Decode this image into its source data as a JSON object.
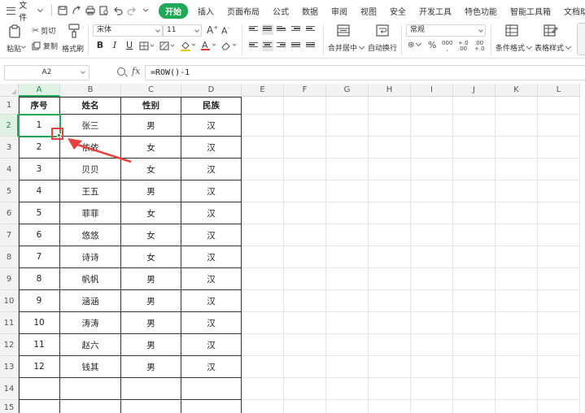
{
  "menubar": {
    "file_label": "文件",
    "tabs": [
      {
        "label": "开始",
        "active": true
      },
      {
        "label": "插入",
        "active": false
      },
      {
        "label": "页面布局",
        "active": false
      },
      {
        "label": "公式",
        "active": false
      },
      {
        "label": "数据",
        "active": false
      },
      {
        "label": "审阅",
        "active": false
      },
      {
        "label": "视图",
        "active": false
      },
      {
        "label": "安全",
        "active": false
      },
      {
        "label": "开发工具",
        "active": false
      },
      {
        "label": "特色功能",
        "active": false
      },
      {
        "label": "智能工具箱",
        "active": false
      },
      {
        "label": "文档助手",
        "active": false
      }
    ],
    "active_color": "#1fa855"
  },
  "ribbon": {
    "paste_label": "粘贴",
    "cut_label": "剪切",
    "copy_label": "复制",
    "format_painter_label": "格式刷",
    "font_name": "宋体",
    "font_size": "11",
    "bold": "B",
    "italic": "I",
    "underline": "U",
    "number_format": "常规",
    "merge_center_label": "合并居中",
    "wrap_text_label": "自动换行",
    "conditional_format_label": "条件格式",
    "table_style_label": "表格样式",
    "percent": "%",
    "thousands": "000",
    "increase_decimal": "+.0",
    "decrease_decimal": ".00"
  },
  "formulabar": {
    "name_box": "A2",
    "fx_label": "fx",
    "formula": "=ROW()-1"
  },
  "sheet": {
    "columns": [
      "A",
      "B",
      "C",
      "D",
      "E",
      "F",
      "G",
      "H",
      "I",
      "J",
      "K",
      "L"
    ],
    "selected_column": "A",
    "row_numbers": [
      "1",
      "2",
      "3",
      "4",
      "5",
      "6",
      "7",
      "8",
      "9",
      "10",
      "11",
      "12",
      "13",
      "14",
      "15"
    ],
    "selected_row": "2",
    "header": [
      "序号",
      "姓名",
      "性别",
      "民族"
    ],
    "rows": [
      [
        "1",
        "张三",
        "男",
        "汉"
      ],
      [
        "2",
        "依依",
        "女",
        "汉"
      ],
      [
        "3",
        "贝贝",
        "女",
        "汉"
      ],
      [
        "4",
        "王五",
        "男",
        "汉"
      ],
      [
        "5",
        "菲菲",
        "女",
        "汉"
      ],
      [
        "6",
        "悠悠",
        "女",
        "汉"
      ],
      [
        "7",
        "诗诗",
        "女",
        "汉"
      ],
      [
        "8",
        "帆帆",
        "男",
        "汉"
      ],
      [
        "9",
        "涵涵",
        "男",
        "汉"
      ],
      [
        "10",
        "涛涛",
        "男",
        "汉"
      ],
      [
        "11",
        "赵六",
        "男",
        "汉"
      ],
      [
        "12",
        "钱其",
        "男",
        "汉"
      ]
    ],
    "annotation_color": "#e8403a"
  }
}
